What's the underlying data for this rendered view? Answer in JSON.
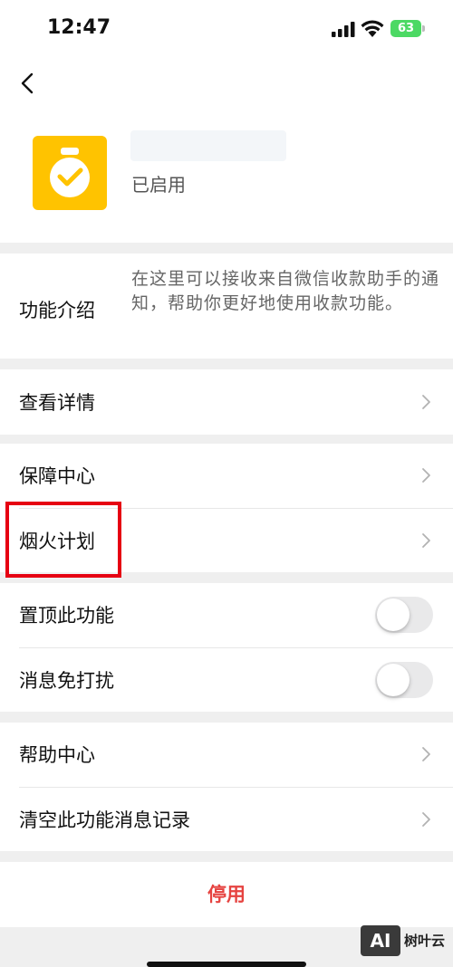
{
  "status_bar": {
    "time": "12:47",
    "battery": "63"
  },
  "app": {
    "status": "已启用"
  },
  "intro": {
    "label": "功能介绍",
    "text": "在这里可以接收来自微信收款助手的通知，帮助你更好地使用收款功能。"
  },
  "rows": {
    "details": "查看详情",
    "guarantee": "保障中心",
    "fireworks": "烟火计划",
    "pin": "置顶此功能",
    "mute": "消息免打扰",
    "help": "帮助中心",
    "clear": "清空此功能消息记录"
  },
  "toggles": {
    "pin_on": false,
    "mute_on": false
  },
  "disable_label": "停用",
  "watermark": {
    "logo": "AI",
    "text": "树叶云"
  },
  "colors": {
    "accent_red": "#e64340",
    "icon_yellow": "#ffc300",
    "highlight": "#e60012"
  }
}
